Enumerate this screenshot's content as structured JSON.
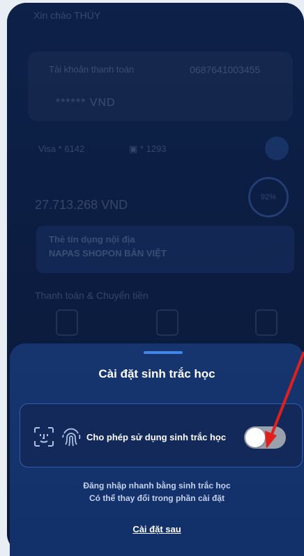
{
  "background": {
    "greeting": "Xin chào THÚY",
    "account_label": "Tài khoản thanh toán",
    "account_number": "0687641003455",
    "balance_masked": "****** VND",
    "card1": "Visa * 6142",
    "card2": "▣ * 1293",
    "amount": "27.713.268 VND",
    "progress_text": "92%",
    "promo_line1": "Thẻ tín dụng nội địa",
    "promo_line2": "NAPAS SHOPON BẢN VIỆT",
    "section_title": "Thanh toán & Chuyển tiền"
  },
  "sheet": {
    "title": "Cài đặt sinh trắc học",
    "biometric_label": "Cho phép sử dụng sinh trắc học",
    "toggle_enabled": false,
    "description_line1": "Đăng nhập nhanh bằng sinh trắc học",
    "description_line2": "Có thể thay đổi trong phần cài đặt",
    "later_link": "Cài đặt sau"
  },
  "icons": {
    "face": "face-id-icon",
    "fingerprint": "fingerprint-icon"
  },
  "colors": {
    "sheet_bg": "#16356e",
    "accent": "#3f86e8",
    "toggle_off": "#9aa1ad",
    "arrow": "#e0201b"
  }
}
